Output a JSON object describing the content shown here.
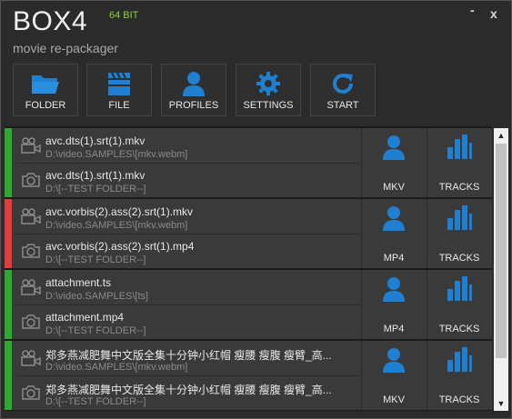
{
  "app": {
    "title": "BOX4",
    "bits": "64 BIT",
    "subtitle": "movie re-packager",
    "minimize": "-",
    "close": "x"
  },
  "toolbar": {
    "folder": "FOLDER",
    "file": "FILE",
    "profiles": "PROFILES",
    "settings": "SETTINGS",
    "start": "START"
  },
  "colors": {
    "accent": "#1f7fd0",
    "ok": "#2fa82f",
    "error": "#e43a3a"
  },
  "jobs": [
    {
      "status": "ok",
      "source_name": "avc.dts(1).srt(1).mkv",
      "source_path": "D:\\video.SAMPLES\\[mkv.webm]",
      "output_name": "avc.dts(1).srt(1).mkv",
      "output_path": "D:\\[--TEST FOLDER--]",
      "profile": "MKV",
      "tracks": "TRACKS"
    },
    {
      "status": "error",
      "source_name": "avc.vorbis(2).ass(2).srt(1).mkv",
      "source_path": "D:\\video.SAMPLES\\[mkv.webm]",
      "output_name": "avc.vorbis(2).ass(2).srt(1).mp4",
      "output_path": "D:\\[--TEST FOLDER--]",
      "profile": "MP4",
      "tracks": "TRACKS"
    },
    {
      "status": "ok",
      "source_name": "attachment.ts",
      "source_path": "D:\\video.SAMPLES\\[ts]",
      "output_name": "attachment.mp4",
      "output_path": "D:\\[--TEST FOLDER--]",
      "profile": "MP4",
      "tracks": "TRACKS"
    },
    {
      "status": "ok",
      "source_name": "郑多燕减肥舞中文版全集十分钟小红帽 瘦腰 瘦腹 瘦臂_高...",
      "source_path": "D:\\video.SAMPLES\\[mkv.webm]",
      "output_name": "郑多燕减肥舞中文版全集十分钟小红帽 瘦腰 瘦腹 瘦臂_高...",
      "output_path": "D:\\[--TEST FOLDER--]",
      "profile": "MKV",
      "tracks": "TRACKS"
    }
  ],
  "scrollbar": {
    "up": "▲",
    "down": "▼"
  },
  "icons": {
    "folder": "folder-icon",
    "file": "clapperboard-icon",
    "profiles": "user-icon",
    "settings": "gear-icon",
    "start": "refresh-icon",
    "source": "movie-camera-icon",
    "output": "camera-icon",
    "tracks": "bar-chart-icon"
  }
}
